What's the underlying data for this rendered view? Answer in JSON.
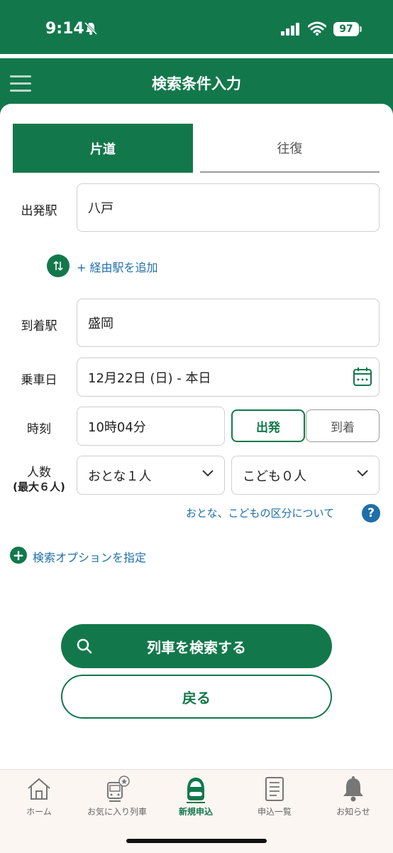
{
  "status_bar": {
    "time": "9:14",
    "battery": "97"
  },
  "header": {
    "title": "検索条件入力"
  },
  "trip_tabs": {
    "one_way": "片道",
    "round_trip": "往復"
  },
  "departure": {
    "label": "出発駅",
    "value": "八戸"
  },
  "via": {
    "link": "+ 経由駅を追加"
  },
  "arrival": {
    "label": "到着駅",
    "value": "盛岡"
  },
  "date": {
    "label": "乗車日",
    "value": "12月22日 (日) - 本日"
  },
  "time": {
    "label": "時刻",
    "value": "10時04分",
    "depart": "出発",
    "arrive": "到着"
  },
  "passengers": {
    "label_line1": "人数",
    "label_line2": "(最大６人)",
    "adults": "おとな１人",
    "children": "こども０人",
    "info_link": "おとな、こどもの区分について",
    "help": "?"
  },
  "options": {
    "plus": "+",
    "link": "検索オプションを指定"
  },
  "buttons": {
    "search": "列車を検索する",
    "back": "戻る"
  },
  "tabbar": {
    "items": [
      {
        "label": "ホーム",
        "icon": "home-icon"
      },
      {
        "label": "お気に入り列車",
        "icon": "favorite-train-icon"
      },
      {
        "label": "新規申込",
        "icon": "new-application-icon",
        "active": true
      },
      {
        "label": "申込一覧",
        "icon": "application-list-icon"
      },
      {
        "label": "お知らせ",
        "icon": "bell-icon"
      }
    ]
  },
  "colors": {
    "primary": "#12784b",
    "link": "#1f6fa8",
    "tabbar_bg": "#fbf6f1"
  }
}
